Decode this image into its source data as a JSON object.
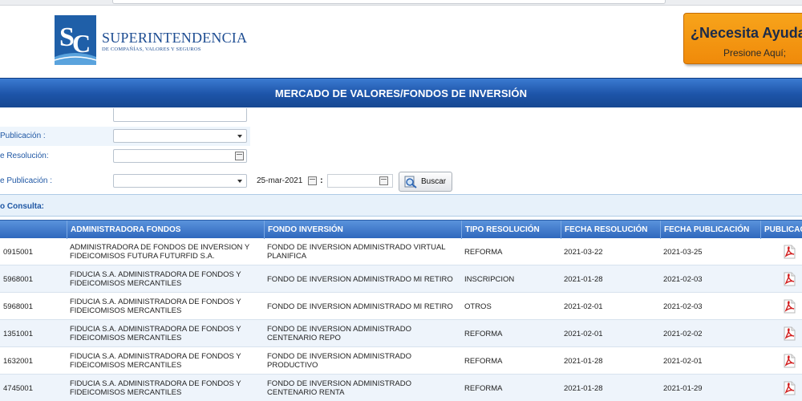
{
  "header": {
    "brand_line1": "SUPERINTENDENCIA",
    "brand_line2": "DE COMPAÑÍAS, VALORES Y SEGUROS",
    "help_title": "¿Necesita Ayuda",
    "help_subtitle": "Presione Aquí;",
    "colors": {
      "brand": "#1e4d92",
      "help_bg": "#f39a12",
      "title_bar": "#1d54a8"
    }
  },
  "page_title": "MERCADO DE VALORES/FONDOS DE INVERSIÓN",
  "filters": {
    "tipo_publicacion_label": "Publicación :",
    "fecha_resolucion_label": "e Resolución:",
    "fecha_publicacion_label": "e Publicación :",
    "fecha_desde": "25-mar-2021",
    "range_separator": ":",
    "search_button": "Buscar"
  },
  "result_label": "o Consulta:",
  "table": {
    "columns": [
      "",
      "ADMINISTRADORA FONDOS",
      "FONDO INVERSIÓN",
      "TIPO RESOLUCIÓN",
      "FECHA RESOLUCIÓN",
      "FECHA PUBLICACIÓN",
      "PUBLICACIÓ"
    ],
    "rows": [
      {
        "id": "0915001",
        "admin1": "ADMINISTRADORA DE FONDOS DE INVERSION Y",
        "admin2": "FIDEICOMISOS FUTURA FUTURFID S.A.",
        "fondo1": "FONDO DE INVERSION ADMINISTRADO VIRTUAL",
        "fondo2": "PLANIFICA",
        "tipo": "REFORMA",
        "fres": "2021-03-22",
        "fpub": "2021-03-25"
      },
      {
        "id": "5968001",
        "admin1": "FIDUCIA S.A. ADMINISTRADORA DE FONDOS Y",
        "admin2": "FIDEICOMISOS MERCANTILES",
        "fondo1": "FONDO DE INVERSION ADMINISTRADO MI RETIRO",
        "fondo2": "",
        "tipo": "INSCRIPCION",
        "fres": "2021-01-28",
        "fpub": "2021-02-03"
      },
      {
        "id": "5968001",
        "admin1": "FIDUCIA S.A. ADMINISTRADORA DE FONDOS Y",
        "admin2": "FIDEICOMISOS MERCANTILES",
        "fondo1": "FONDO DE INVERSION ADMINISTRADO MI RETIRO",
        "fondo2": "",
        "tipo": "OTROS",
        "fres": "2021-02-01",
        "fpub": "2021-02-03"
      },
      {
        "id": "1351001",
        "admin1": "FIDUCIA S.A. ADMINISTRADORA DE FONDOS Y",
        "admin2": "FIDEICOMISOS MERCANTILES",
        "fondo1": "FONDO DE INVERSION ADMINISTRADO",
        "fondo2": "CENTENARIO REPO",
        "tipo": "REFORMA",
        "fres": "2021-02-01",
        "fpub": "2021-02-02"
      },
      {
        "id": "1632001",
        "admin1": "FIDUCIA S.A. ADMINISTRADORA DE FONDOS Y",
        "admin2": "FIDEICOMISOS MERCANTILES",
        "fondo1": "FONDO DE INVERSION ADMINISTRADO",
        "fondo2": "PRODUCTIVO",
        "tipo": "REFORMA",
        "fres": "2021-01-28",
        "fpub": "2021-02-01"
      },
      {
        "id": "4745001",
        "admin1": "FIDUCIA S.A. ADMINISTRADORA DE FONDOS Y",
        "admin2": "FIDEICOMISOS MERCANTILES",
        "fondo1": "FONDO DE INVERSION ADMINISTRADO",
        "fondo2": "CENTENARIO RENTA",
        "tipo": "REFORMA",
        "fres": "2021-01-28",
        "fpub": "2021-01-29"
      }
    ]
  },
  "icons": {
    "pdf": "pdf-icon",
    "calendar": "calendar-icon",
    "search": "magnifier-icon"
  }
}
